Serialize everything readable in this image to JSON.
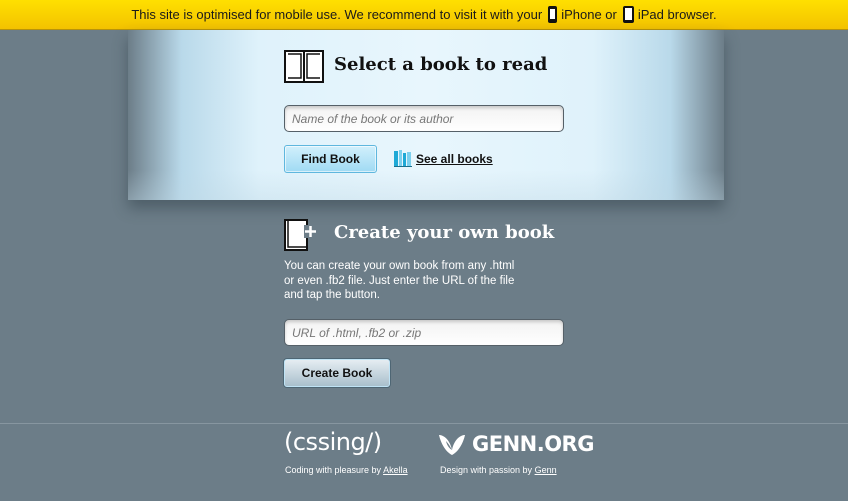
{
  "banner": {
    "text_before": "This site is optimised for mobile use. We recommend to visit it with your",
    "iphone_label": "iPhone or",
    "ipad_label": "iPad browser.",
    "iphone_icon": "iphone-icon",
    "ipad_icon": "ipad-icon",
    "color": "#f7cf00"
  },
  "select_section": {
    "title": "Select a book to read",
    "search_placeholder": "Name of the book or its author",
    "search_value": "",
    "find_button": "Find Book",
    "see_all_link": "See all books",
    "icon": "open-book-icon",
    "link_icon": "bookshelf-icon"
  },
  "create_section": {
    "title": "Create your own book",
    "description": "You can create your own book from any .html\nor even .fb2 file. Just enter the URL of the file\nand tap the button.",
    "url_placeholder": "URL of .html, .fb2 or .zip",
    "url_value": "",
    "create_button": "Create Book",
    "icon": "new-book-icon"
  },
  "footer": {
    "cssing_logo": "(cssing/)",
    "cssing_credit_prefix": "Coding with pleasure by",
    "cssing_credit_name": "Akella",
    "genn_logo": "GENN.ORG",
    "genn_credit_prefix": "Design with passion by",
    "genn_credit_name": "Genn"
  },
  "colors": {
    "background": "#6c7d88",
    "panel": "#e3f4fc",
    "accent": "#9fdaf3"
  }
}
